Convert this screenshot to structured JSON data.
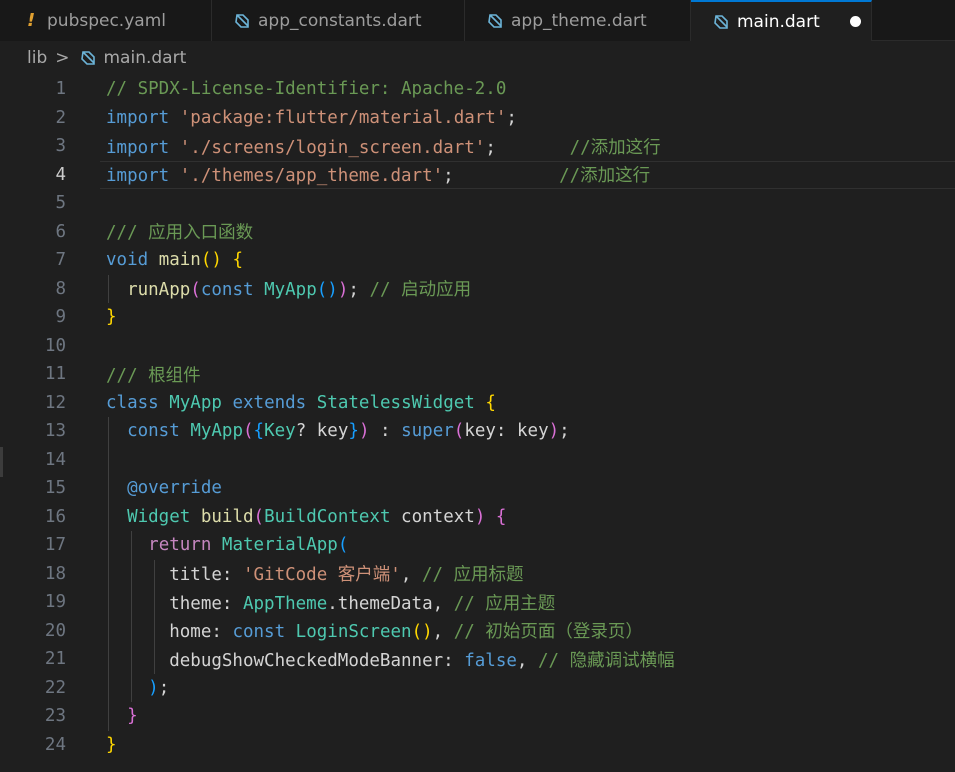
{
  "tabs": [
    {
      "label": "pubspec.yaml",
      "icon": "yaml-exclaim-icon",
      "active": false
    },
    {
      "label": "app_constants.dart",
      "icon": "dart-icon",
      "active": false
    },
    {
      "label": "app_theme.dart",
      "icon": "dart-icon",
      "active": false
    },
    {
      "label": "main.dart",
      "icon": "dart-icon",
      "active": true,
      "modified": true
    }
  ],
  "breadcrumb": {
    "folder": "lib",
    "separator": ">",
    "file": "main.dart"
  },
  "editor": {
    "active_line": 4,
    "lines": [
      {
        "n": "1",
        "tokens": [
          {
            "t": "// SPDX-License-Identifier: Apache-2.0",
            "c": "c-comment"
          }
        ]
      },
      {
        "n": "2",
        "tokens": [
          {
            "t": "import",
            "c": "c-kw"
          },
          {
            "t": " ",
            "c": "c-plain"
          },
          {
            "t": "'package:flutter/material.dart'",
            "c": "c-str"
          },
          {
            "t": ";",
            "c": "c-plain"
          }
        ]
      },
      {
        "n": "3",
        "tokens": [
          {
            "t": "import",
            "c": "c-kw"
          },
          {
            "t": " ",
            "c": "c-plain"
          },
          {
            "t": "'./screens/login_screen.dart'",
            "c": "c-str"
          },
          {
            "t": ";       ",
            "c": "c-plain"
          },
          {
            "t": "//添加这行",
            "c": "c-comment"
          }
        ]
      },
      {
        "n": "4",
        "tokens": [
          {
            "t": "import",
            "c": "c-kw"
          },
          {
            "t": " ",
            "c": "c-plain"
          },
          {
            "t": "'./themes/app_theme.dart'",
            "c": "c-str"
          },
          {
            "t": ";          ",
            "c": "c-plain"
          },
          {
            "t": "//添加这行",
            "c": "c-comment"
          }
        ]
      },
      {
        "n": "5",
        "tokens": []
      },
      {
        "n": "6",
        "tokens": [
          {
            "t": "/// 应用入口函数",
            "c": "c-comment"
          }
        ]
      },
      {
        "n": "7",
        "tokens": [
          {
            "t": "void",
            "c": "c-kw"
          },
          {
            "t": " ",
            "c": "c-plain"
          },
          {
            "t": "main",
            "c": "c-fn"
          },
          {
            "t": "()",
            "c": "c-b1"
          },
          {
            "t": " ",
            "c": "c-plain"
          },
          {
            "t": "{",
            "c": "c-b1"
          }
        ]
      },
      {
        "n": "8",
        "tokens": [
          {
            "t": "  ",
            "c": "c-plain"
          },
          {
            "t": "runApp",
            "c": "c-fn"
          },
          {
            "t": "(",
            "c": "c-b2"
          },
          {
            "t": "const",
            "c": "c-kw"
          },
          {
            "t": " ",
            "c": "c-plain"
          },
          {
            "t": "MyApp",
            "c": "c-type"
          },
          {
            "t": "()",
            "c": "c-b3"
          },
          {
            "t": ")",
            "c": "c-b2"
          },
          {
            "t": "; ",
            "c": "c-plain"
          },
          {
            "t": "// 启动应用",
            "c": "c-comment"
          }
        ]
      },
      {
        "n": "9",
        "tokens": [
          {
            "t": "}",
            "c": "c-b1"
          }
        ]
      },
      {
        "n": "10",
        "tokens": []
      },
      {
        "n": "11",
        "tokens": [
          {
            "t": "/// 根组件",
            "c": "c-comment"
          }
        ]
      },
      {
        "n": "12",
        "tokens": [
          {
            "t": "class",
            "c": "c-kw"
          },
          {
            "t": " ",
            "c": "c-plain"
          },
          {
            "t": "MyApp",
            "c": "c-type"
          },
          {
            "t": " ",
            "c": "c-plain"
          },
          {
            "t": "extends",
            "c": "c-kw"
          },
          {
            "t": " ",
            "c": "c-plain"
          },
          {
            "t": "StatelessWidget",
            "c": "c-type"
          },
          {
            "t": " ",
            "c": "c-plain"
          },
          {
            "t": "{",
            "c": "c-b1"
          }
        ]
      },
      {
        "n": "13",
        "tokens": [
          {
            "t": "  ",
            "c": "c-plain"
          },
          {
            "t": "const",
            "c": "c-kw"
          },
          {
            "t": " ",
            "c": "c-plain"
          },
          {
            "t": "MyApp",
            "c": "c-type"
          },
          {
            "t": "(",
            "c": "c-b2"
          },
          {
            "t": "{",
            "c": "c-b3"
          },
          {
            "t": "Key",
            "c": "c-type"
          },
          {
            "t": "? key",
            "c": "c-plain"
          },
          {
            "t": "}",
            "c": "c-b3"
          },
          {
            "t": ")",
            "c": "c-b2"
          },
          {
            "t": " : ",
            "c": "c-plain"
          },
          {
            "t": "super",
            "c": "c-kw"
          },
          {
            "t": "(",
            "c": "c-b2"
          },
          {
            "t": "key: key",
            "c": "c-plain"
          },
          {
            "t": ")",
            "c": "c-b2"
          },
          {
            "t": ";",
            "c": "c-plain"
          }
        ]
      },
      {
        "n": "14",
        "tokens": []
      },
      {
        "n": "15",
        "tokens": [
          {
            "t": "  ",
            "c": "c-plain"
          },
          {
            "t": "@override",
            "c": "c-kw"
          }
        ]
      },
      {
        "n": "16",
        "tokens": [
          {
            "t": "  ",
            "c": "c-plain"
          },
          {
            "t": "Widget",
            "c": "c-type"
          },
          {
            "t": " ",
            "c": "c-plain"
          },
          {
            "t": "build",
            "c": "c-fn"
          },
          {
            "t": "(",
            "c": "c-b2"
          },
          {
            "t": "BuildContext",
            "c": "c-type"
          },
          {
            "t": " context",
            "c": "c-plain"
          },
          {
            "t": ")",
            "c": "c-b2"
          },
          {
            "t": " ",
            "c": "c-plain"
          },
          {
            "t": "{",
            "c": "c-b2"
          }
        ]
      },
      {
        "n": "17",
        "tokens": [
          {
            "t": "    ",
            "c": "c-plain"
          },
          {
            "t": "return",
            "c": "c-ctrl"
          },
          {
            "t": " ",
            "c": "c-plain"
          },
          {
            "t": "MaterialApp",
            "c": "c-type"
          },
          {
            "t": "(",
            "c": "c-b3"
          }
        ]
      },
      {
        "n": "18",
        "tokens": [
          {
            "t": "      title: ",
            "c": "c-plain"
          },
          {
            "t": "'GitCode 客户端'",
            "c": "c-str"
          },
          {
            "t": ", ",
            "c": "c-plain"
          },
          {
            "t": "// 应用标题",
            "c": "c-comment"
          }
        ]
      },
      {
        "n": "19",
        "tokens": [
          {
            "t": "      theme: ",
            "c": "c-plain"
          },
          {
            "t": "AppTheme",
            "c": "c-type"
          },
          {
            "t": ".themeData, ",
            "c": "c-plain"
          },
          {
            "t": "// 应用主题",
            "c": "c-comment"
          }
        ]
      },
      {
        "n": "20",
        "tokens": [
          {
            "t": "      home: ",
            "c": "c-plain"
          },
          {
            "t": "const",
            "c": "c-kw"
          },
          {
            "t": " ",
            "c": "c-plain"
          },
          {
            "t": "LoginScreen",
            "c": "c-type"
          },
          {
            "t": "()",
            "c": "c-b1"
          },
          {
            "t": ", ",
            "c": "c-plain"
          },
          {
            "t": "// 初始页面（登录页）",
            "c": "c-comment"
          }
        ]
      },
      {
        "n": "21",
        "tokens": [
          {
            "t": "      debugShowCheckedModeBanner: ",
            "c": "c-plain"
          },
          {
            "t": "false",
            "c": "c-kw"
          },
          {
            "t": ", ",
            "c": "c-plain"
          },
          {
            "t": "// 隐藏调试横幅",
            "c": "c-comment"
          }
        ]
      },
      {
        "n": "22",
        "tokens": [
          {
            "t": "    ",
            "c": "c-plain"
          },
          {
            "t": ")",
            "c": "c-b3"
          },
          {
            "t": ";",
            "c": "c-plain"
          }
        ]
      },
      {
        "n": "23",
        "tokens": [
          {
            "t": "  ",
            "c": "c-plain"
          },
          {
            "t": "}",
            "c": "c-b2"
          }
        ]
      },
      {
        "n": "24",
        "tokens": [
          {
            "t": "}",
            "c": "c-b1"
          }
        ]
      }
    ]
  }
}
